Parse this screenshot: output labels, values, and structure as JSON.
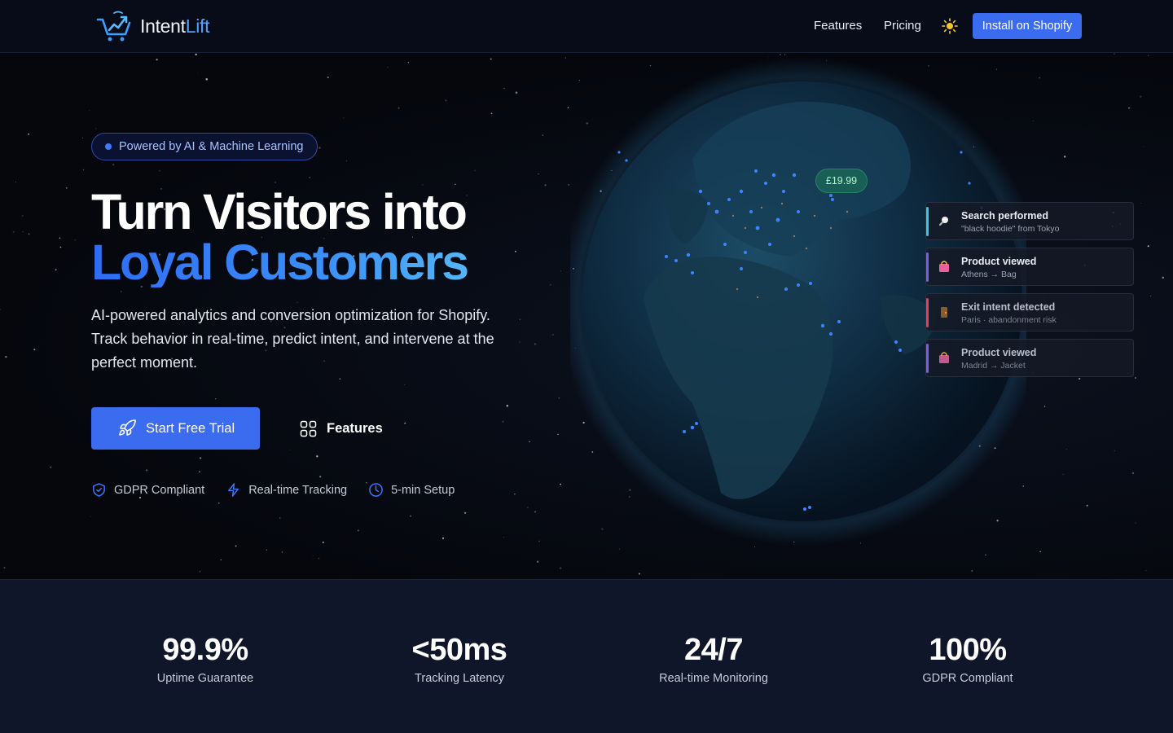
{
  "brand": {
    "name_part1": "Intent",
    "name_part2": "Lift"
  },
  "nav": {
    "features": "Features",
    "pricing": "Pricing",
    "theme_icon": "sun-icon",
    "install": "Install on Shopify"
  },
  "hero": {
    "pill": "Powered by AI & Machine Learning",
    "title_line1": "Turn Visitors into",
    "title_line2": "Loyal Customers",
    "subtitle": "AI-powered analytics and conversion optimization for Shopify. Track behavior in real-time, predict intent, and intervene at the perfect moment.",
    "cta_primary": "Start Free Trial",
    "cta_secondary": "Features",
    "badges": [
      {
        "label": "GDPR Compliant",
        "icon": "shield-check-icon"
      },
      {
        "label": "Real-time Tracking",
        "icon": "lightning-icon"
      },
      {
        "label": "5-min Setup",
        "icon": "clock-icon"
      }
    ]
  },
  "globe": {
    "price_tag": "£19.99",
    "events": [
      {
        "title": "Search performed",
        "detail": "\"black hoodie\" from Tokyo",
        "icon": "search-icon",
        "color": "#35c6e8"
      },
      {
        "title": "Product viewed",
        "detail": "Athens → Bag",
        "icon": "shopping-bag-icon",
        "color": "#7a5cf0"
      },
      {
        "title": "Exit intent detected",
        "detail": "Paris · abandonment risk",
        "icon": "door-icon",
        "color": "#e0405e"
      },
      {
        "title": "Product viewed",
        "detail": "Madrid → Jacket",
        "icon": "shopping-bag-icon",
        "color": "#7a5cf0"
      }
    ]
  },
  "stats": [
    {
      "value": "99.9%",
      "label": "Uptime Guarantee"
    },
    {
      "value": "<50ms",
      "label": "Tracking Latency"
    },
    {
      "value": "24/7",
      "label": "Real-time Monitoring"
    },
    {
      "value": "100%",
      "label": "GDPR Compliant"
    }
  ],
  "colors": {
    "accent": "#3b6cf0",
    "background": "#070b16",
    "stats_bg": "#0f1629"
  }
}
